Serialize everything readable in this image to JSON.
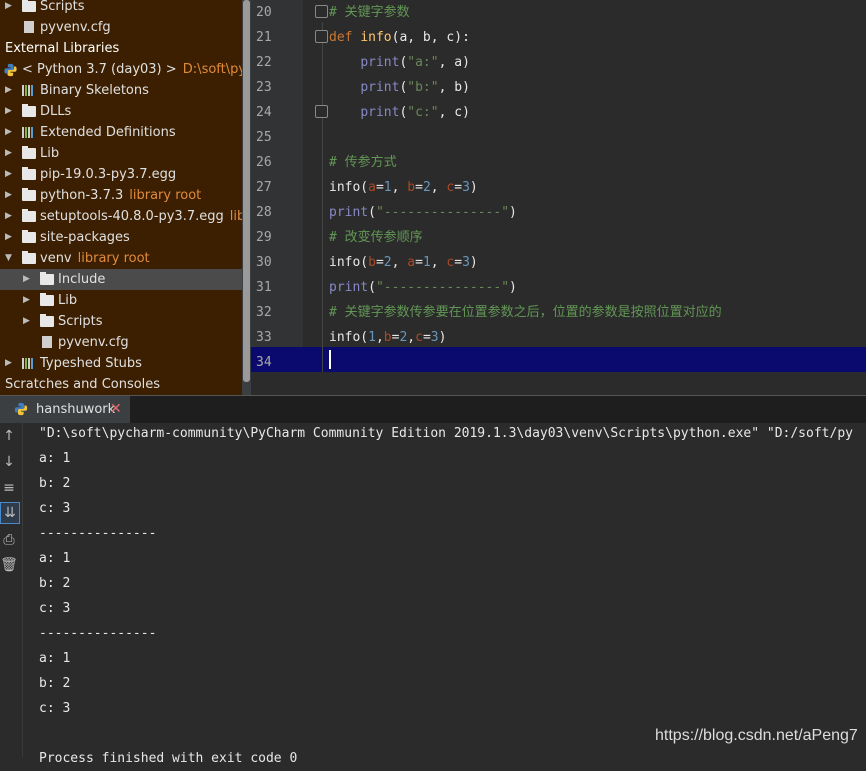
{
  "project_tree": {
    "top_items": [
      {
        "label": "Scripts",
        "kind": "folder"
      },
      {
        "label": "pyvenv.cfg",
        "kind": "file"
      }
    ],
    "external_libraries": "External Libraries",
    "python_sdk": {
      "label": "< Python 3.7 (day03) >",
      "path": "D:\\soft\\pychar"
    },
    "items": [
      {
        "label": "Binary Skeletons",
        "sub": ""
      },
      {
        "label": "DLLs",
        "sub": ""
      },
      {
        "label": "Extended Definitions",
        "sub": ""
      },
      {
        "label": "Lib",
        "sub": ""
      },
      {
        "label": "pip-19.0.3-py3.7.egg",
        "sub": ""
      },
      {
        "label": "python-3.7.3",
        "sub": "library root"
      },
      {
        "label": "setuptools-40.8.0-py3.7.egg",
        "sub": "library"
      },
      {
        "label": "site-packages",
        "sub": ""
      },
      {
        "label": "venv",
        "sub": "library root"
      },
      {
        "label": "Include",
        "sub": ""
      },
      {
        "label": "Lib",
        "sub": ""
      },
      {
        "label": "Scripts",
        "sub": ""
      },
      {
        "label": "pyvenv.cfg",
        "sub": ""
      },
      {
        "label": "Typeshed Stubs",
        "sub": ""
      }
    ],
    "scratches": "Scratches and Consoles"
  },
  "editor": {
    "line_numbers": [
      "20",
      "21",
      "22",
      "23",
      "24",
      "25",
      "26",
      "27",
      "28",
      "29",
      "30",
      "31",
      "32",
      "33",
      "34"
    ],
    "lines": [
      [
        {
          "t": "# 关键字参数",
          "c": "cm"
        }
      ],
      [
        {
          "t": "def ",
          "c": "kw"
        },
        {
          "t": "info",
          "c": "fn"
        },
        {
          "t": "(a, b, c):",
          "c": "plain"
        }
      ],
      [
        {
          "t": "    ",
          "c": "plain"
        },
        {
          "t": "print",
          "c": "bi"
        },
        {
          "t": "(",
          "c": "plain"
        },
        {
          "t": "\"a:\"",
          "c": "str"
        },
        {
          "t": ", a)",
          "c": "plain"
        }
      ],
      [
        {
          "t": "    ",
          "c": "plain"
        },
        {
          "t": "print",
          "c": "bi"
        },
        {
          "t": "(",
          "c": "plain"
        },
        {
          "t": "\"b:\"",
          "c": "str"
        },
        {
          "t": ", b)",
          "c": "plain"
        }
      ],
      [
        {
          "t": "    ",
          "c": "plain"
        },
        {
          "t": "print",
          "c": "bi"
        },
        {
          "t": "(",
          "c": "plain"
        },
        {
          "t": "\"c:\"",
          "c": "str"
        },
        {
          "t": ", c)",
          "c": "plain"
        }
      ],
      [],
      [
        {
          "t": "# 传参方式",
          "c": "cm"
        }
      ],
      [
        {
          "t": "info(",
          "c": "plain"
        },
        {
          "t": "a",
          "c": "param"
        },
        {
          "t": "=",
          "c": "plain"
        },
        {
          "t": "1",
          "c": "num"
        },
        {
          "t": ", ",
          "c": "plain"
        },
        {
          "t": "b",
          "c": "param"
        },
        {
          "t": "=",
          "c": "plain"
        },
        {
          "t": "2",
          "c": "num"
        },
        {
          "t": ", ",
          "c": "plain"
        },
        {
          "t": "c",
          "c": "param"
        },
        {
          "t": "=",
          "c": "plain"
        },
        {
          "t": "3",
          "c": "num"
        },
        {
          "t": ")",
          "c": "plain"
        }
      ],
      [
        {
          "t": "print",
          "c": "bi"
        },
        {
          "t": "(",
          "c": "plain"
        },
        {
          "t": "\"---------------\"",
          "c": "str"
        },
        {
          "t": ")",
          "c": "plain"
        }
      ],
      [
        {
          "t": "# 改变传参顺序",
          "c": "cm"
        }
      ],
      [
        {
          "t": "info(",
          "c": "plain"
        },
        {
          "t": "b",
          "c": "param"
        },
        {
          "t": "=",
          "c": "plain"
        },
        {
          "t": "2",
          "c": "num"
        },
        {
          "t": ", ",
          "c": "plain"
        },
        {
          "t": "a",
          "c": "param"
        },
        {
          "t": "=",
          "c": "plain"
        },
        {
          "t": "1",
          "c": "num"
        },
        {
          "t": ", ",
          "c": "plain"
        },
        {
          "t": "c",
          "c": "param"
        },
        {
          "t": "=",
          "c": "plain"
        },
        {
          "t": "3",
          "c": "num"
        },
        {
          "t": ")",
          "c": "plain"
        }
      ],
      [
        {
          "t": "print",
          "c": "bi"
        },
        {
          "t": "(",
          "c": "plain"
        },
        {
          "t": "\"---------------\"",
          "c": "str"
        },
        {
          "t": ")",
          "c": "plain"
        }
      ],
      [
        {
          "t": "# 关键字参数传参要在位置参数之后，位置的参数是按照位置对应的",
          "c": "cm"
        }
      ],
      [
        {
          "t": "info(",
          "c": "plain"
        },
        {
          "t": "1",
          "c": "num"
        },
        {
          "t": ",",
          "c": "plain"
        },
        {
          "t": "b",
          "c": "param"
        },
        {
          "t": "=",
          "c": "plain"
        },
        {
          "t": "2",
          "c": "num"
        },
        {
          "t": ",",
          "c": "plain"
        },
        {
          "t": "c",
          "c": "param"
        },
        {
          "t": "=",
          "c": "plain"
        },
        {
          "t": "3",
          "c": "num"
        },
        {
          "t": ")",
          "c": "plain"
        }
      ],
      []
    ]
  },
  "run": {
    "tab_label": "hanshuwork",
    "close_glyph": "✕",
    "command": "\"D:\\soft\\pycharm-community\\PyCharm Community Edition 2019.1.3\\day03\\venv\\Scripts\\python.exe\" \"D:/soft/py",
    "output": [
      "a: 1",
      "b: 2",
      "c: 3",
      "---------------",
      "a: 1",
      "b: 2",
      "c: 3",
      "---------------",
      "a: 1",
      "b: 2",
      "c: 3",
      "",
      "Process finished with exit code 0"
    ]
  },
  "watermark": "https://blog.csdn.net/aPeng7",
  "colors": {
    "tree_bg": "#3c1f01",
    "library_root": "#e08a3c",
    "current_line": "#0a0a6e",
    "tab_accent": "#4a88c7"
  }
}
